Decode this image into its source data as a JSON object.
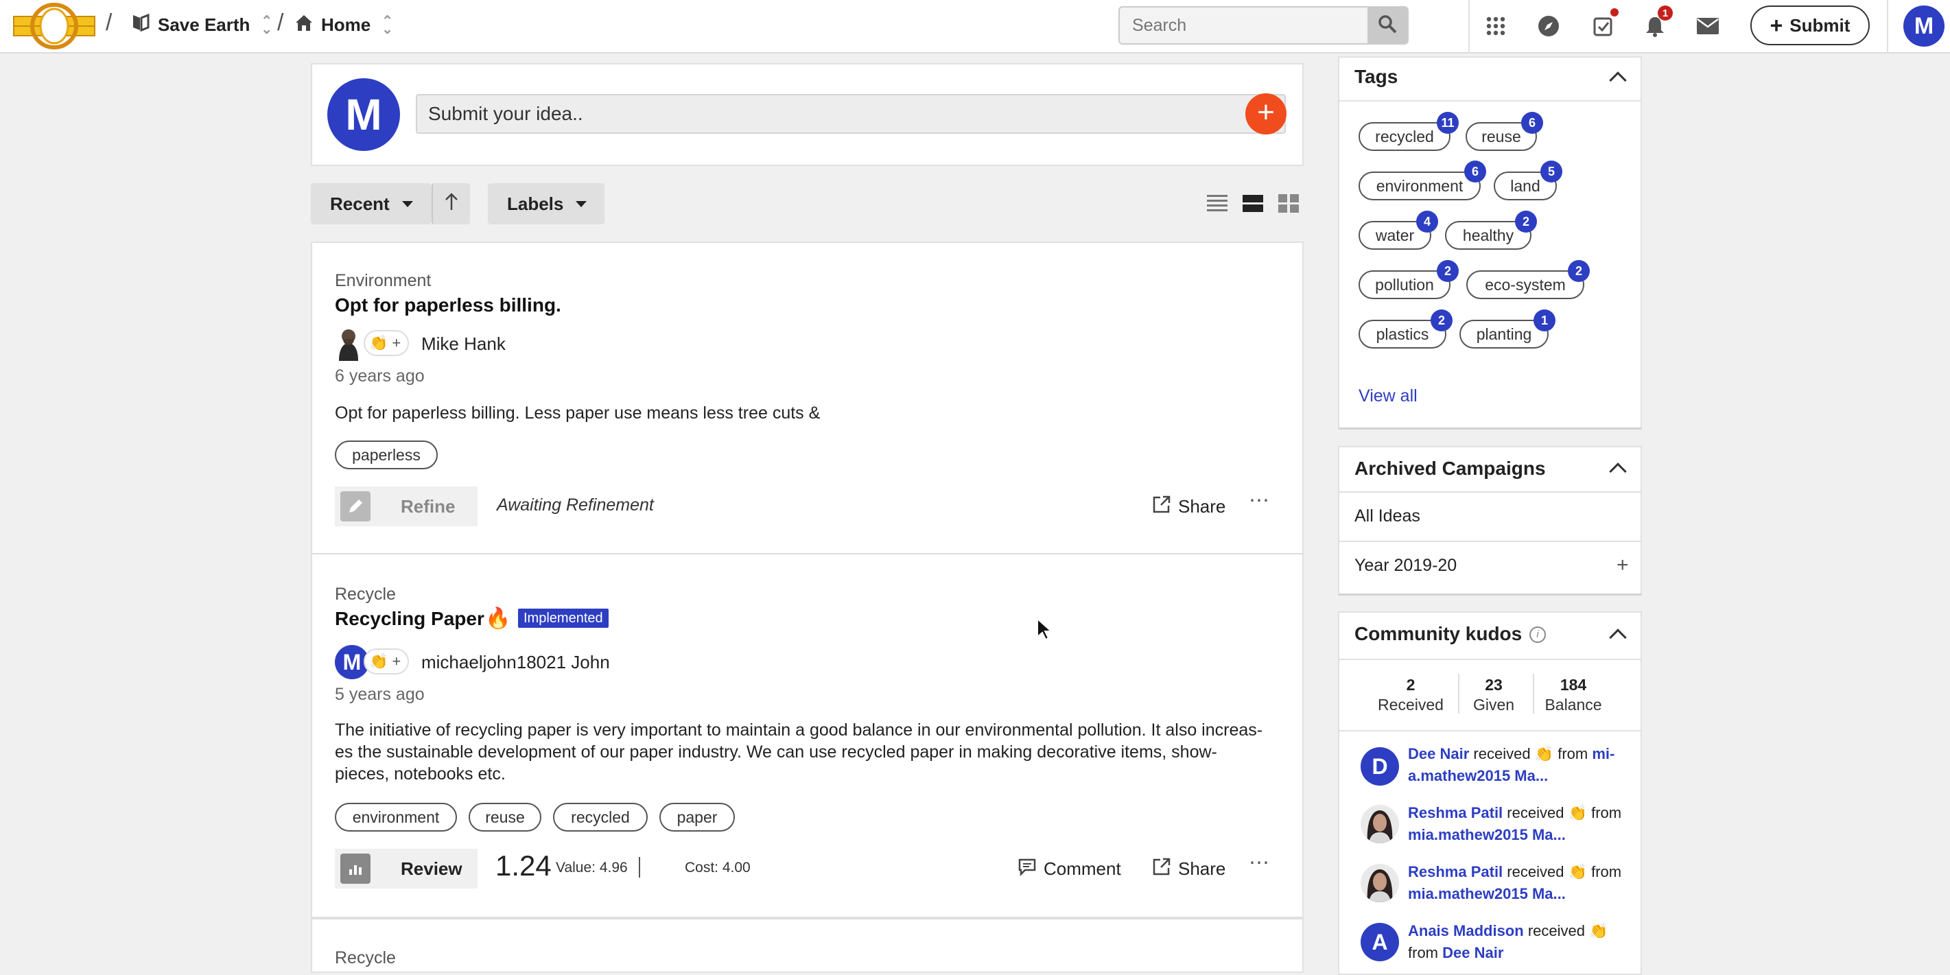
{
  "breadcrumb": {
    "sep": "/",
    "workspace": "Save Earth",
    "page": "Home"
  },
  "search": {
    "placeholder": "Search"
  },
  "notifications": {
    "count": "1"
  },
  "header": {
    "submit_label": "Submit",
    "user_initial": "M"
  },
  "composer": {
    "avatar_initial": "M",
    "placeholder": "Submit your idea.."
  },
  "toolbar": {
    "sort_label": "Recent",
    "labels_label": "Labels"
  },
  "ideas": [
    {
      "category": "Environment",
      "title": "Opt for paperless billing.",
      "author": "Mike Hank",
      "ago": "6 years ago",
      "body": "Opt for paperless billing. Less paper use means less tree cuts &",
      "tags": [
        "paperless"
      ],
      "action": "Refine",
      "status": "Awaiting Refinement",
      "share": "Share"
    },
    {
      "category": "Recycle",
      "title": "Recycling Paper",
      "badge": "Implemented",
      "author_initial": "M",
      "author": "michaeljohn18021 John",
      "ago": "5 years ago",
      "body_lines": [
        "The initiative of recycling paper is very important to maintain a good balance in our environmental pollution. It also increas-",
        "es the sustainable development of our paper industry. We can use recycled paper in making decorative items, show-",
        "pieces, notebooks etc."
      ],
      "tags": [
        "environment",
        "reuse",
        "recycled",
        "paper"
      ],
      "action": "Review",
      "score": "1.24",
      "value": "Value: 4.96",
      "cost": "Cost: 4.00",
      "comment": "Comment",
      "share": "Share"
    },
    {
      "category": "Recycle"
    }
  ],
  "tags_panel": {
    "title": "Tags",
    "tags": [
      {
        "label": "recycled",
        "count": "11"
      },
      {
        "label": "reuse",
        "count": "6"
      },
      {
        "label": "environment",
        "count": "6"
      },
      {
        "label": "land",
        "count": "5"
      },
      {
        "label": "water",
        "count": "4"
      },
      {
        "label": "healthy",
        "count": "2"
      },
      {
        "label": "pollution",
        "count": "2"
      },
      {
        "label": "eco-system",
        "count": "2"
      },
      {
        "label": "plastics",
        "count": "2"
      },
      {
        "label": "planting",
        "count": "1"
      }
    ],
    "view_all": "View all"
  },
  "archived": {
    "title": "Archived Campaigns",
    "items": [
      "All Ideas",
      "Year 2019-20"
    ]
  },
  "kudos": {
    "title": "Community kudos",
    "received": "2",
    "received_label": "Received",
    "given": "23",
    "given_label": "Given",
    "balance": "184",
    "balance_label": "Balance",
    "feed": [
      {
        "initial": "D",
        "user": "Dee Nair",
        "verb": "received",
        "from": "from",
        "source1": "mi-",
        "source2": "a.mathew2015 Ma..."
      },
      {
        "user": "Reshma Patil",
        "verb": "received",
        "from": "from",
        "source2": "mia.mathew2015 Ma..."
      },
      {
        "user": "Reshma Patil",
        "verb": "received",
        "from": "from",
        "source2": "mia.mathew2015 Ma..."
      },
      {
        "initial": "A",
        "user": "Anais Maddison",
        "verb": "received",
        "from": "from",
        "source2": "Dee Nair"
      }
    ]
  },
  "colors": {
    "accent": "#2d3ec2",
    "orange": "#f04c1d",
    "implemented": "#2d3ec2",
    "alert": "#c4201c"
  }
}
